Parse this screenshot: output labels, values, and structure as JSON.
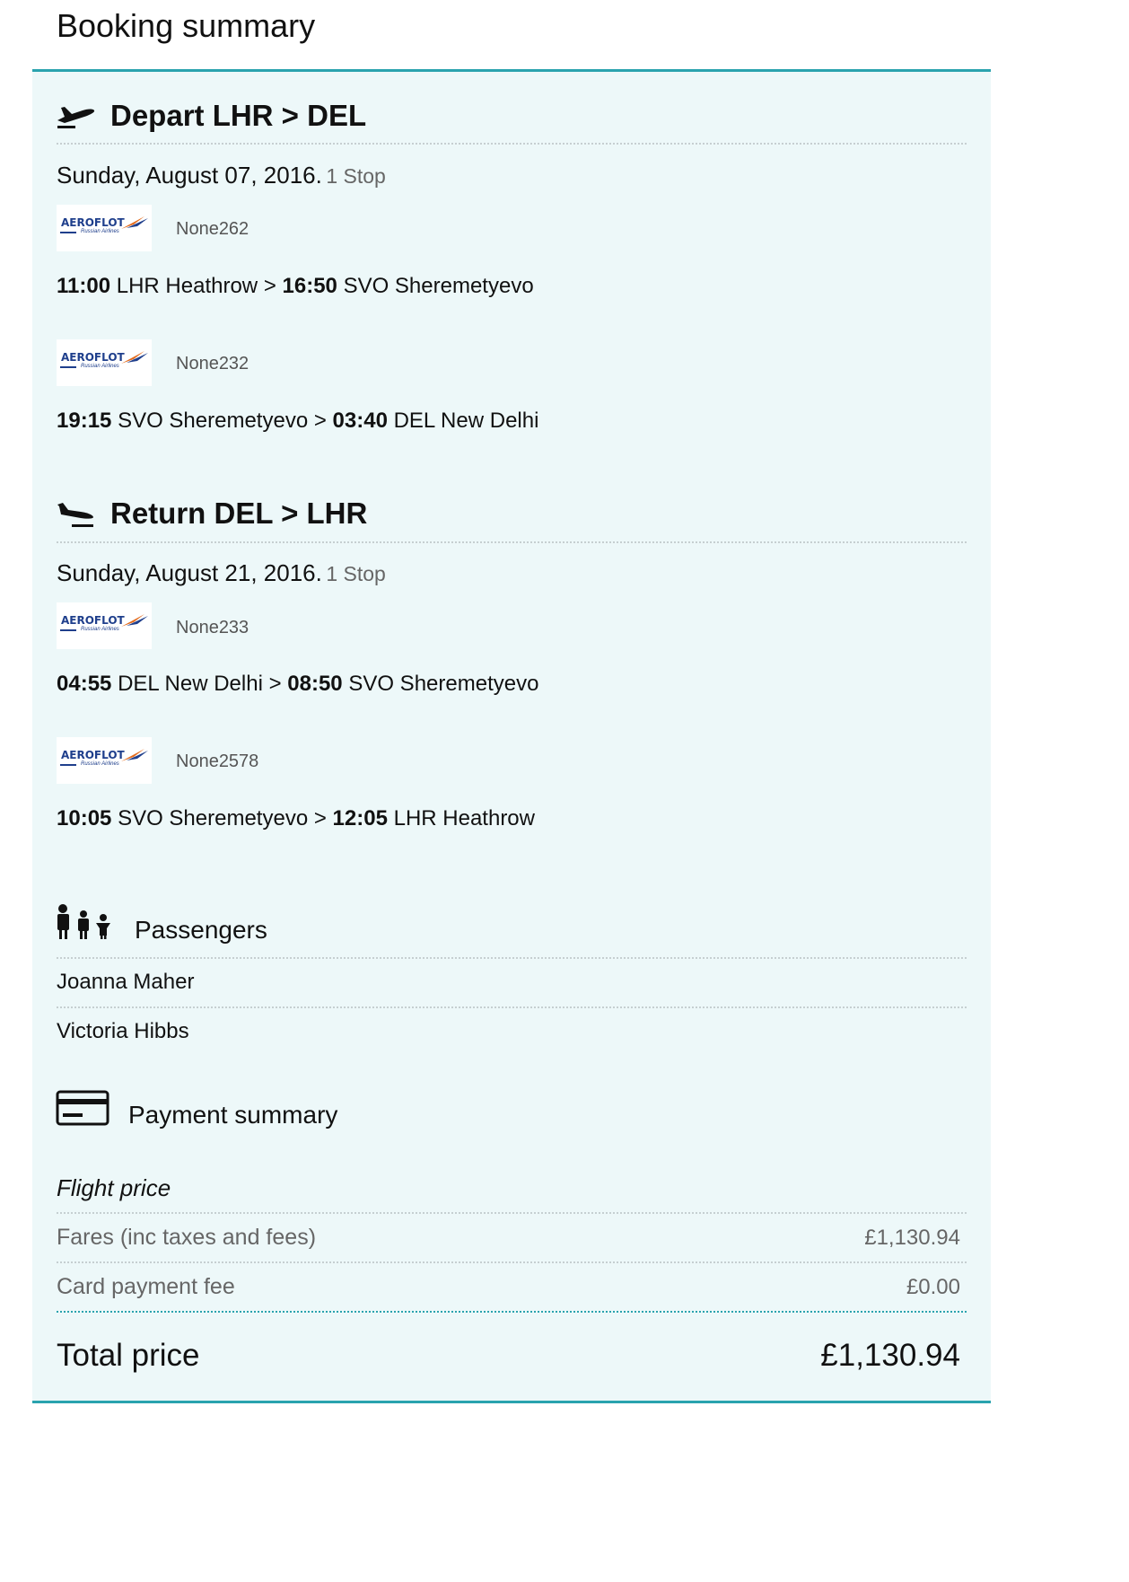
{
  "page_title": "Booking summary",
  "colors": {
    "accent": "#2aa3ae",
    "panel_bg": "#edf8f9",
    "airline_blue": "#1f3f8c",
    "airline_orange": "#e36b1d"
  },
  "depart": {
    "icon": "plane-takeoff-icon",
    "heading": "Depart LHR > DEL",
    "date": "Sunday, August 07, 2016.",
    "stops": "1 Stop",
    "segments": [
      {
        "airline": "AEROFLOT",
        "airline_sub": "Russian Airlines",
        "flight_no": "None262",
        "dep_time": "11:00",
        "dep_place": "LHR Heathrow",
        "sep": ">",
        "arr_time": "16:50",
        "arr_place": "SVO Sheremetyevo"
      },
      {
        "airline": "AEROFLOT",
        "airline_sub": "Russian Airlines",
        "flight_no": "None232",
        "dep_time": "19:15",
        "dep_place": "SVO Sheremetyevo",
        "sep": ">",
        "arr_time": "03:40",
        "arr_place": "DEL New Delhi"
      }
    ]
  },
  "return": {
    "icon": "plane-landing-icon",
    "heading": "Return DEL > LHR",
    "date": "Sunday, August 21, 2016.",
    "stops": "1 Stop",
    "segments": [
      {
        "airline": "AEROFLOT",
        "airline_sub": "Russian Airlines",
        "flight_no": "None233",
        "dep_time": "04:55",
        "dep_place": "DEL New Delhi",
        "sep": ">",
        "arr_time": "08:50",
        "arr_place": "SVO Sheremetyevo"
      },
      {
        "airline": "AEROFLOT",
        "airline_sub": "Russian Airlines",
        "flight_no": "None2578",
        "dep_time": "10:05",
        "dep_place": "SVO Sheremetyevo",
        "sep": ">",
        "arr_time": "12:05",
        "arr_place": "LHR Heathrow"
      }
    ]
  },
  "passengers": {
    "icon": "family-icon",
    "heading": "Passengers",
    "names": [
      "Joanna Maher",
      "Victoria Hibbs"
    ]
  },
  "payment": {
    "icon": "credit-card-icon",
    "heading": "Payment summary",
    "flight_price_label": "Flight price",
    "lines": [
      {
        "label": "Fares (inc taxes and fees)",
        "value": "£1,130.94"
      },
      {
        "label": "Card payment fee",
        "value": "£0.00"
      }
    ],
    "total_label": "Total price",
    "total_value": "£1,130.94"
  }
}
